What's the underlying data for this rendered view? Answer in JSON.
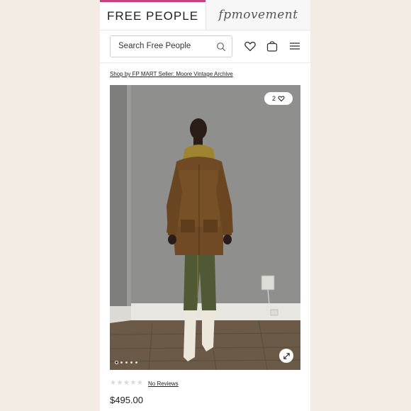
{
  "header": {
    "brand_tab": "FREE PEOPLE",
    "movement_tab": "fpmovement",
    "accent_color": "#c0477d"
  },
  "search": {
    "placeholder": "Search Free People",
    "icon": "search-icon"
  },
  "header_icons": [
    "heart-icon",
    "shopping-bag-icon",
    "menu-icon"
  ],
  "seller_link": "Shop by FP MART Seller: Moore Vintage Archive",
  "product": {
    "like_count": "2",
    "image_count": 5,
    "active_image": 1,
    "rating_stars": "★★★★★",
    "reviews_text": "No Reviews",
    "price": "$495.00"
  }
}
